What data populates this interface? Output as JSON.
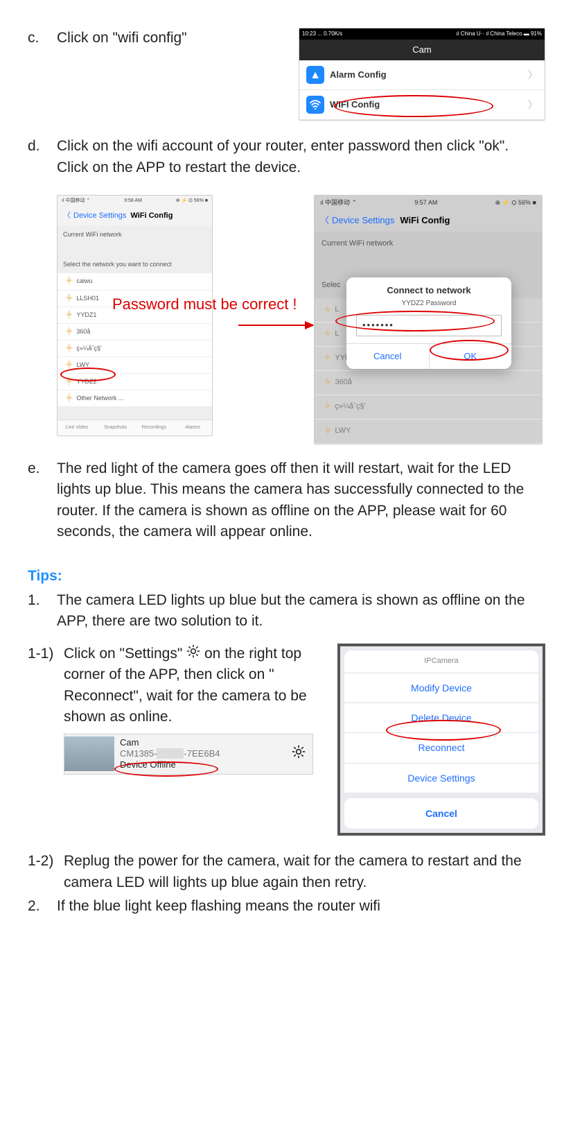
{
  "steps": {
    "c": {
      "label": "c.",
      "text": "Click on \"wifi config\""
    },
    "d": {
      "label": "d.",
      "text1": "Click on the wifi account of your router, enter password then click \"ok\".",
      "text2": "Click on the APP to restart the device."
    },
    "e": {
      "label": "e.",
      "text": "The red light of the camera goes off then it will restart, wait for the LED lights up blue. This means the camera has successfully connected to the router. If the camera is shown as offline on the APP, please wait for 60 seconds, the camera will appear online."
    }
  },
  "tips": {
    "header": "Tips:",
    "item1": {
      "label": "1.",
      "text": "The camera LED lights up blue but the camera is shown as offline on the APP, there are two solution to it."
    },
    "item1_1": {
      "label": "1-1)",
      "text_a": "Click on \"Settings\"",
      "text_b": "on the right top corner of the APP,  then click on \" Reconnect\", wait for the camera to be shown as online."
    },
    "item1_2": {
      "label": "1-2)",
      "text": "Replug the power for the camera, wait for the camera to restart and  the camera LED will lights up blue again then retry."
    },
    "item2": {
      "label": "2.",
      "text": "If the blue light keep flashing means the router wifi"
    }
  },
  "annotation": {
    "password_must": "Password must be correct !"
  },
  "shot_cam": {
    "status_left": "10:23 ... 0.70K/s",
    "status_right": "ıl China U··  ıl China Teleco   ▬ 91%",
    "title": "Cam",
    "row1": "Alarm Config",
    "row2": "WIFI Config"
  },
  "shot_left": {
    "status_left": "ıl 中国移动 ⌃",
    "status_mid": "9:58 AM",
    "status_right": "⊕ ⚡ ⛭ 56% ■",
    "back": "Device Settings",
    "title": "WiFi Config",
    "section1": "Current WiFi network",
    "section2": "Select the network you want to connect",
    "nets": [
      "caiwu",
      "LLSH01",
      "YYDZ1",
      "360å",
      "ç»¼åˆç§'",
      "LWY",
      "YYDZ2",
      "Other Network ..."
    ],
    "tabs": [
      "Live Video",
      "Snapshots",
      "Recordings",
      "Alarms"
    ]
  },
  "shot_right": {
    "status_left": "ıl 中国移动 ⌃",
    "status_mid": "9:57 AM",
    "status_right": "⊕ ⚡ ⛭ 56% ■",
    "back": "Device Settings",
    "title": "WiFi Config",
    "section1": "Current WiFi network",
    "section2_prefix": "Selec",
    "nets_bg": [
      "L",
      "L",
      "YYDZ1",
      "360å",
      "ç»¼åˆç§'",
      "LWY"
    ],
    "dialog": {
      "title": "Connect to network",
      "sub": "YYDZ2 Password",
      "value": "•••••••",
      "cancel": "Cancel",
      "ok": "OK"
    }
  },
  "camstrip": {
    "name": "Cam",
    "id_a": "CM1385-",
    "id_b": "-7EE6B4",
    "status": "Device Offline"
  },
  "sheet": {
    "head": "IPCamera",
    "items": [
      "Modify Device",
      "Delete Device",
      "Reconnect",
      "Device Settings"
    ],
    "cancel": "Cancel"
  }
}
